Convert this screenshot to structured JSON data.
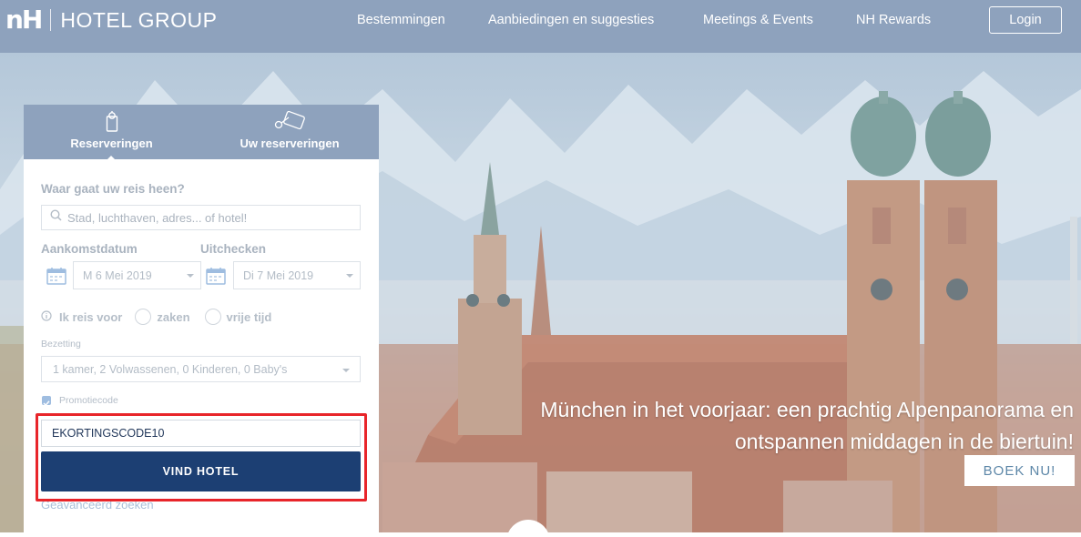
{
  "header": {
    "logo_mark": "nH",
    "logo_text": "HOTEL GROUP",
    "nav": [
      "Bestemmingen",
      "Aanbiedingen en suggesties",
      "Meetings & Events",
      "NH Rewards"
    ],
    "login_label": "Login"
  },
  "booking": {
    "tabs": [
      "Reserveringen",
      "Uw reserveringen"
    ],
    "destination_label": "Waar gaat uw reis heen?",
    "destination_placeholder": "Stad, luchthaven, adres... of hotel!",
    "arrival_label": "Aankomstdatum",
    "arrival_value": "M 6 Mei 2019",
    "checkout_label": "Uitchecken",
    "checkout_value": "Di 7 Mei 2019",
    "travel_label": "Ik reis voor",
    "travel_options": [
      "zaken",
      "vrije tijd"
    ],
    "occupancy_label": "Bezetting",
    "occupancy_value": "1 kamer, 2 Volwassenen, 0 Kinderen, 0 Baby's",
    "promo_label": "Promotiecode",
    "promo_checked": true,
    "promo_value": "EKORTINGSCODE10",
    "find_label": "VIND HOTEL",
    "advanced_label": "Geavanceerd zoeken"
  },
  "hero": {
    "caption_line1": "München in het voorjaar: een prachtig Alpenpanorama en",
    "caption_line2": "ontspannen middagen in de biertuin!",
    "book_label": "BOEK NU!"
  },
  "colors": {
    "header_bg": "#8ea2bd",
    "primary_button": "#1c3f73",
    "highlight": "#e8252a"
  },
  "icons": [
    "door-hanger-icon",
    "key-card-icon",
    "search-icon",
    "calendar-icon",
    "info-icon",
    "checkbox-icon"
  ]
}
